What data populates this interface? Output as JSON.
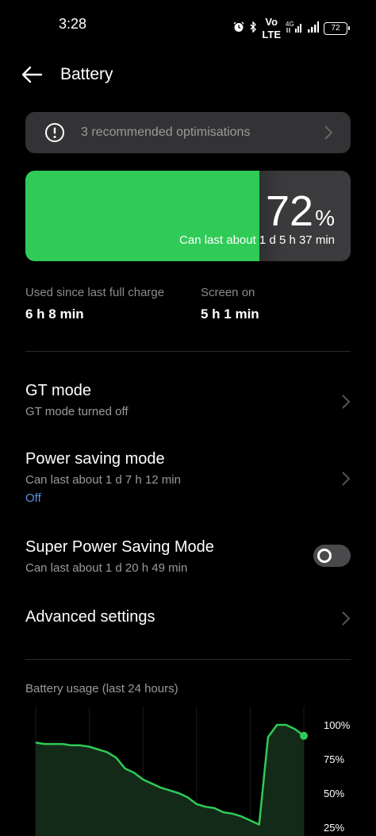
{
  "status_bar": {
    "time": "3:28",
    "icons": [
      "alarm-icon",
      "bluetooth-icon",
      "volte-icon",
      "signal-4g-icon",
      "signal-bars-icon"
    ],
    "volte_text": "Vo\nLTE",
    "network": "4G",
    "battery": "72"
  },
  "header": {
    "title": "Battery",
    "back_icon": "arrow-left-icon"
  },
  "recommendation": {
    "text": "3 recommended optimisations",
    "icon": "info-icon"
  },
  "battery": {
    "percent": "72",
    "percent_sign": "%",
    "level": 0.72,
    "estimate": "Can last about 1 d 5 h 37 min",
    "fill_color": "#2fcb56"
  },
  "usage": {
    "since_charge_label": "Used since last full charge",
    "since_charge_value": "6 h 8 min",
    "screen_on_label": "Screen on",
    "screen_on_value": "5 h 1 min"
  },
  "settings": {
    "gt_mode": {
      "title": "GT mode",
      "subtitle": "GT mode turned off"
    },
    "power_saving": {
      "title": "Power saving mode",
      "subtitle": "Can last about 1 d 7 h 12 min",
      "status": "Off"
    },
    "super_power_saving": {
      "title": "Super Power Saving Mode",
      "subtitle": "Can last about 1 d 20 h 49 min",
      "enabled": false
    },
    "advanced": {
      "title": "Advanced settings"
    }
  },
  "chart_title": "Battery usage (last 24 hours)",
  "chart_data": {
    "type": "area",
    "title": "Battery usage (last 24 hours)",
    "y_ticks": [
      "100%",
      "75%",
      "50%",
      "25%"
    ],
    "ylim": [
      25,
      100
    ],
    "x": [
      0,
      1,
      2,
      3,
      4,
      5,
      6,
      7,
      8,
      9,
      10,
      11,
      12,
      13,
      14,
      15,
      16,
      17,
      18,
      19,
      20,
      21,
      22,
      23,
      24,
      25,
      26,
      27,
      28,
      29,
      30
    ],
    "values": [
      87,
      86,
      86,
      86,
      85,
      85,
      84,
      82,
      80,
      76,
      68,
      65,
      60,
      57,
      54,
      52,
      50,
      47,
      42,
      40,
      39,
      36,
      35,
      33,
      30,
      27,
      91,
      100,
      100,
      97,
      92
    ],
    "color": "#2fcb56"
  }
}
